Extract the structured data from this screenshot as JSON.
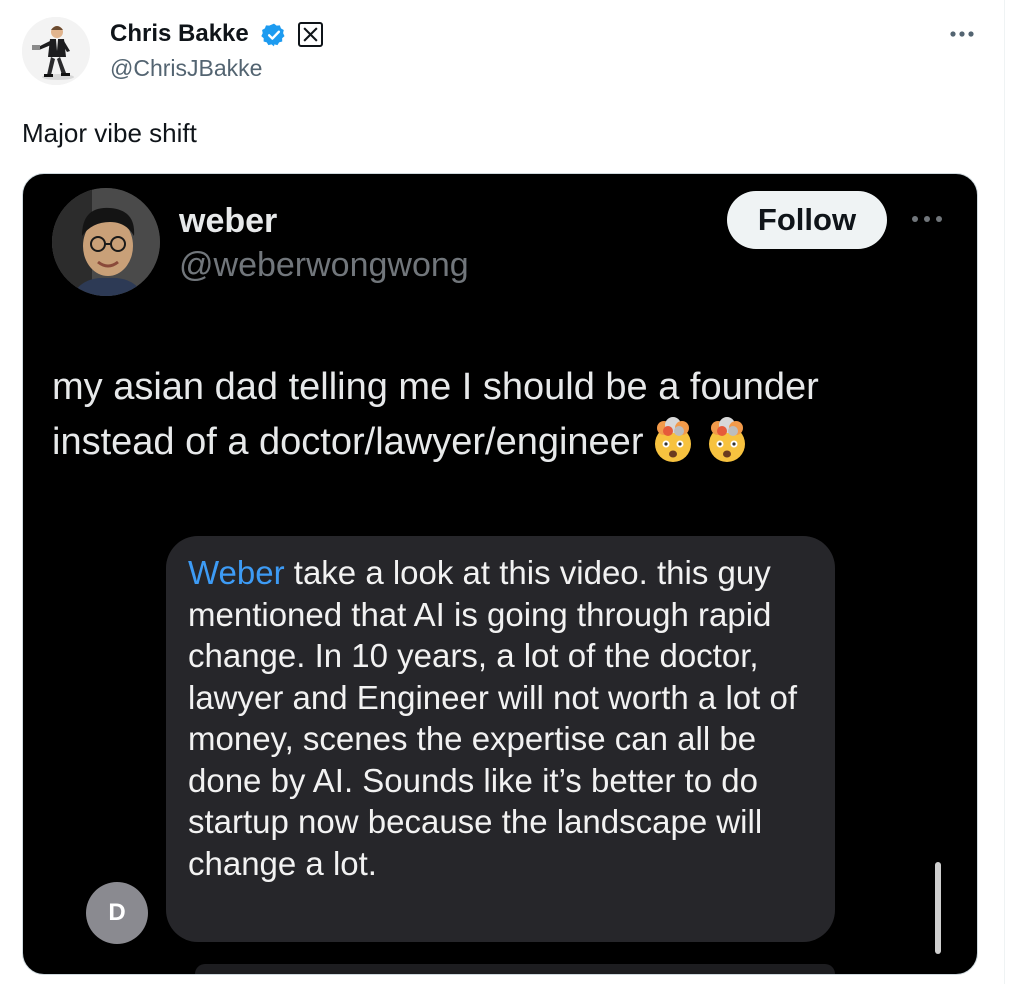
{
  "author": {
    "name": "Chris Bakke",
    "handle": "@ChrisJBakke"
  },
  "tweet": {
    "text": "Major vibe shift"
  },
  "embedded_post": {
    "name": "weber",
    "handle": "@weberwongwong",
    "follow_label": "Follow",
    "text": "my asian dad telling me I should be a founder instead of a doctor/lawyer/engineer",
    "emoji": [
      "exploding-head",
      "exploding-head"
    ]
  },
  "message": {
    "mention": "Weber",
    "body": " take a look at this video. this guy mentioned that AI is going through rapid change.  In 10 years, a lot of the doctor, lawyer and Engineer will not worth a lot of money, scenes the expertise can all be done by AI.   Sounds like it’s better to do startup now because the landscape will change a lot.",
    "sender_initial": "D"
  },
  "colors": {
    "verified": "#1d9bf0",
    "mention": "#3d9bf5",
    "card_bg": "#000000"
  }
}
